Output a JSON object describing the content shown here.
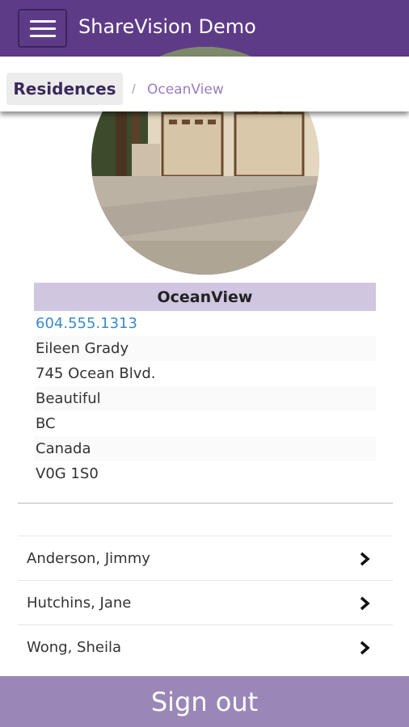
{
  "app_bar": {
    "title": "ShareVision Demo",
    "menu_icon": "hamburger-menu-icon",
    "color": "#5e3b87"
  },
  "breadcrumb": {
    "home_label": "Residences",
    "separator": "/",
    "current": "OceanView"
  },
  "residence": {
    "photo": "house-photo",
    "name": "OceanView",
    "phone": "604.555.1313",
    "contact": "Eileen Grady",
    "address": "745 Ocean Blvd.",
    "city": "Beautiful",
    "province": "BC",
    "country": "Canada",
    "postal_code": "V0G 1S0"
  },
  "people": [
    {
      "name": "Anderson, Jimmy",
      "icon": "chevron-right-icon"
    },
    {
      "name": "Hutchins, Jane",
      "icon": "chevron-right-icon"
    },
    {
      "name": "Wong, Sheila",
      "icon": "chevron-right-icon"
    }
  ],
  "footer": {
    "signout_label": "Sign out",
    "color": "#9b86b8"
  }
}
